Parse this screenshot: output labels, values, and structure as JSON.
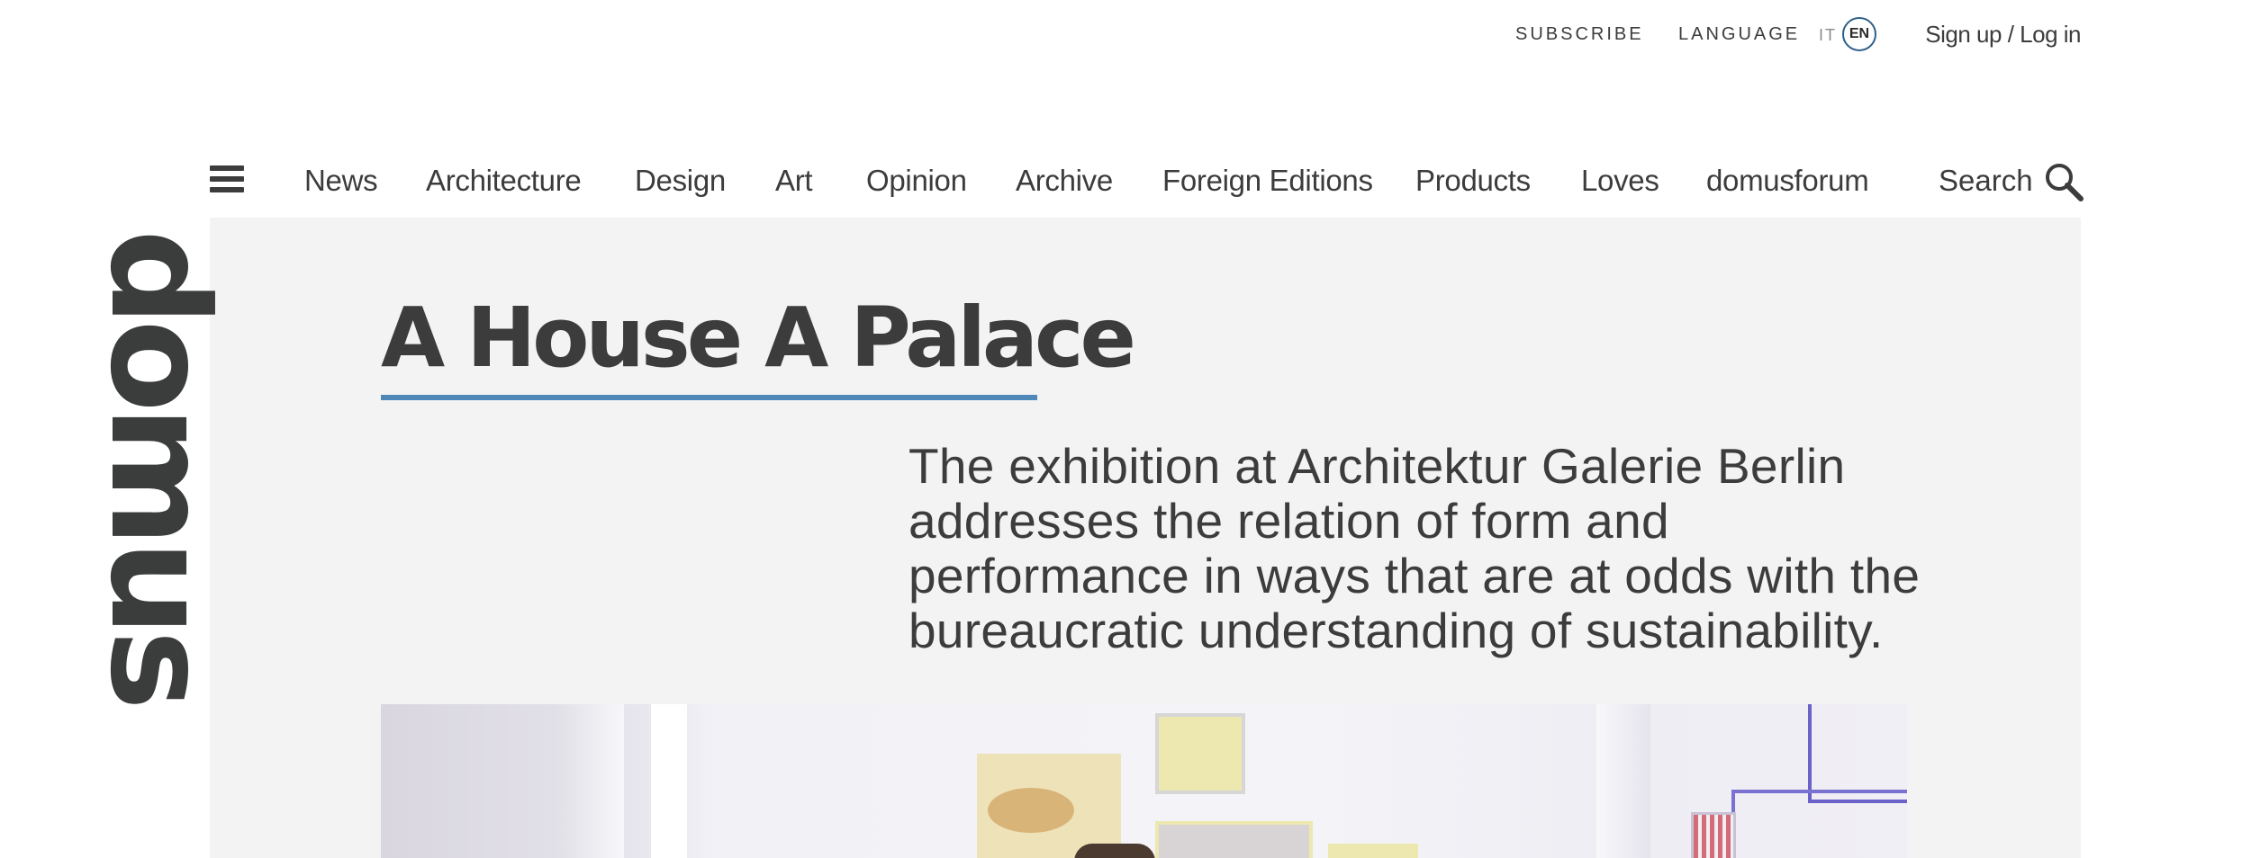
{
  "topbar": {
    "subscribe": "SUBSCRIBE",
    "language": "LANGUAGE",
    "lang_it": "IT",
    "lang_en": "EN",
    "signup": "Sign up / Log in"
  },
  "nav": {
    "menu_icon": "hamburger-menu-icon",
    "items": [
      "News",
      "Architecture",
      "Design",
      "Art",
      "Opinion",
      "Archive",
      "Foreign Editions",
      "Products",
      "Loves",
      "domusforum"
    ],
    "search_label": "Search",
    "search_icon": "search-icon"
  },
  "logo": "domus",
  "article": {
    "title": "A House A Palace",
    "lede": "The exhibition at Architektur Galerie Berlin addresses the relation of form and performance in ways that are at odds with the bureaucratic understanding of sustainability."
  },
  "colors": {
    "accent": "#4d88b8",
    "text": "#3c3c3c",
    "panel": "#f3f3f3",
    "active_language_ring": "#2f5f8a"
  }
}
